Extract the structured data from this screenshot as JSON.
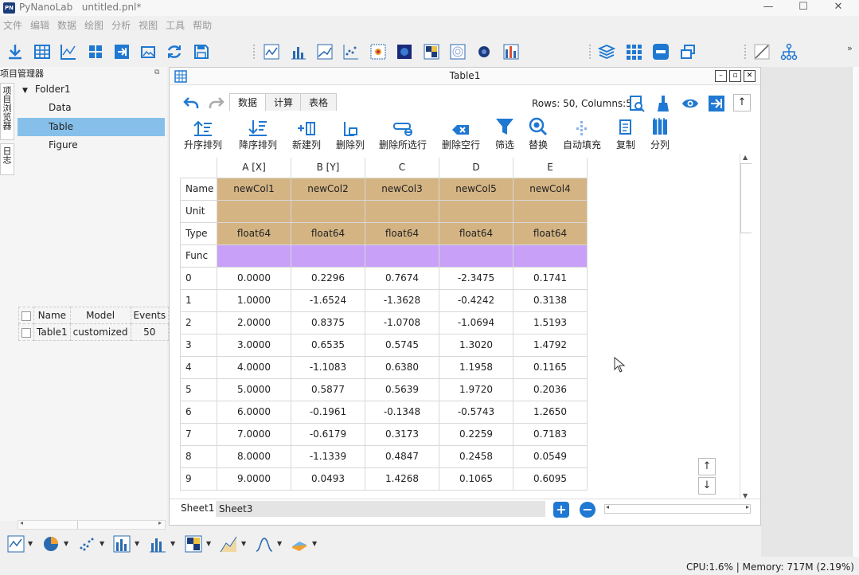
{
  "app": {
    "title": "PyNanoLab",
    "file": "untitled.pnl*",
    "logo_text": "PN",
    "window_buttons": [
      "—",
      "☐",
      "✕"
    ]
  },
  "menu": [
    "文件",
    "编辑",
    "数据",
    "绘图",
    "分析",
    "视图",
    "工具",
    "帮助"
  ],
  "left_panel": {
    "title": "项目管理器",
    "vtabs": [
      "项目浏览器",
      "日志"
    ],
    "tree": [
      {
        "label": "Folder1",
        "expanded": true
      },
      {
        "label": "Data"
      },
      {
        "label": "Table",
        "selected": true
      },
      {
        "label": "Figure"
      }
    ],
    "grid": {
      "headers": [
        "",
        "Name",
        "Model",
        "Events"
      ],
      "rows": [
        [
          "",
          "Table1",
          "customized",
          "50"
        ]
      ]
    }
  },
  "table_window": {
    "title": "Table1",
    "tabs": [
      "数据",
      "计算",
      "表格"
    ],
    "active_tab": 0,
    "rows_columns": "Rows: 50, Columns:5",
    "actions": [
      "升序排列",
      "降序排列",
      "新建列",
      "删除列",
      "删除所选行",
      "删除空行",
      "筛选",
      "替换",
      "自动填充",
      "复制",
      "分列"
    ],
    "column_headers": [
      "A [X]",
      "B [Y]",
      "C",
      "D",
      "E"
    ],
    "meta_rows": [
      {
        "label": "Name",
        "values": [
          "newCol1",
          "newCol2",
          "newCol3",
          "newCol5",
          "newCol4"
        ]
      },
      {
        "label": "Unit",
        "values": [
          "",
          "",
          "",
          "",
          ""
        ]
      },
      {
        "label": "Type",
        "values": [
          "float64",
          "float64",
          "float64",
          "float64",
          "float64"
        ]
      },
      {
        "label": "Func",
        "values": [
          "",
          "",
          "",
          "",
          ""
        ]
      }
    ],
    "data_rows": [
      {
        "index": "0",
        "values": [
          "0.0000",
          "0.2296",
          "0.7674",
          "-2.3475",
          "0.1741"
        ]
      },
      {
        "index": "1",
        "values": [
          "1.0000",
          "-1.6524",
          "-1.3628",
          "-0.4242",
          "0.3138"
        ]
      },
      {
        "index": "2",
        "values": [
          "2.0000",
          "0.8375",
          "-1.0708",
          "-1.0694",
          "1.5193"
        ]
      },
      {
        "index": "3",
        "values": [
          "3.0000",
          "0.6535",
          "0.5745",
          "1.3020",
          "1.4792"
        ]
      },
      {
        "index": "4",
        "values": [
          "4.0000",
          "-1.1083",
          "0.6380",
          "1.1958",
          "0.1165"
        ]
      },
      {
        "index": "5",
        "values": [
          "5.0000",
          "0.5877",
          "0.5639",
          "1.9720",
          "0.2036"
        ]
      },
      {
        "index": "6",
        "values": [
          "6.0000",
          "-0.1961",
          "-0.1348",
          "-0.5743",
          "1.2650"
        ]
      },
      {
        "index": "7",
        "values": [
          "7.0000",
          "-0.6179",
          "0.3173",
          "0.2259",
          "0.7183"
        ]
      },
      {
        "index": "8",
        "values": [
          "8.0000",
          "-1.1339",
          "0.4847",
          "0.2458",
          "0.0549"
        ]
      },
      {
        "index": "9",
        "values": [
          "9.0000",
          "0.0493",
          "1.4268",
          "0.1065",
          "0.6095"
        ]
      }
    ],
    "sheets": [
      "Sheet1",
      "Sheet3"
    ],
    "up_label": "↑",
    "down_label": "↓"
  },
  "status": "CPU:1.6% | Memory: 717M (2.19%)",
  "colors": {
    "accent": "#1f78d1",
    "meta_bg": "#d4b483",
    "func_bg": "#c8a0f8",
    "selection": "#86c0ea"
  }
}
